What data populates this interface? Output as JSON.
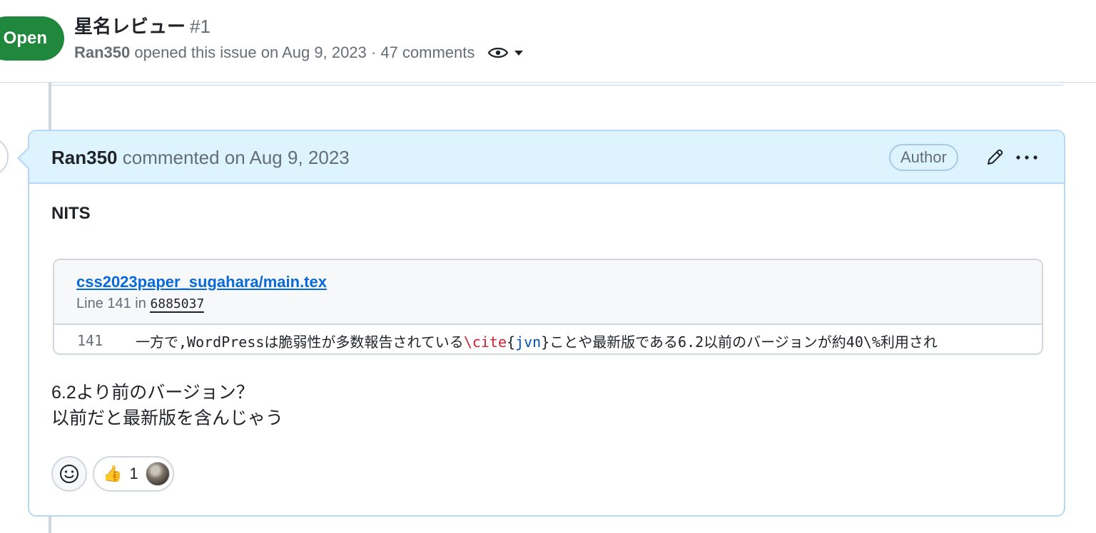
{
  "header": {
    "state": "Open",
    "title": "星名レビュー",
    "number": "#1",
    "meta_author": "Ran350",
    "meta_text": "opened this issue on Aug 9, 2023 · 47 comments",
    "watch_icon": "eye-icon",
    "dropdown_icon": "triangle-down-icon"
  },
  "comment": {
    "author": "Ran350",
    "action": "commented on Aug 9, 2023",
    "badge": "Author",
    "edit_icon": "pencil-icon",
    "more_icon": "kebab-horizontal-icon",
    "body_heading": "NITS",
    "embed": {
      "file": "css2023paper_sugahara/main.tex",
      "line_prefix": "Line 141 in",
      "sha": "6885037",
      "line_number": "141",
      "code_before": "一方で,WordPressは脆弱性が多数報告されている",
      "code_cmd": "\\cite",
      "code_brace_open": "{",
      "code_arg": "jvn",
      "code_brace_close": "}",
      "code_after": "ことや最新版である6.2以前のバージョンが約40\\%利用され"
    },
    "reply_line1": "6.2より前のバージョン？",
    "reply_line2": "以前だと最新版を含んじゃう",
    "reactions": {
      "add_icon": "smiley-icon",
      "emoji": "👍",
      "count": "1"
    }
  },
  "colors": {
    "open_green": "#1f883d",
    "link_blue": "#0969da",
    "header_blue": "#ddf4ff",
    "border_blue": "#b6d7f5",
    "muted": "#656d76"
  }
}
